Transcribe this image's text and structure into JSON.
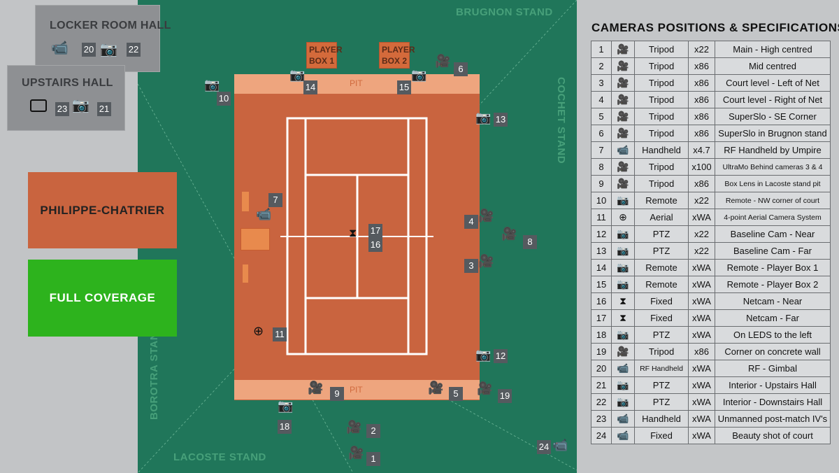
{
  "stands": {
    "brugnon": "BRUGNON STAND",
    "cochet": "COCHET STAND",
    "borotra": "BOROTRA STAND",
    "lacoste": "LACOSTE STAND"
  },
  "halls": {
    "locker_room": {
      "title": "LOCKER ROOM HALL",
      "cams": [
        "20",
        "22"
      ]
    },
    "upstairs": {
      "title": "UPSTAIRS HALL",
      "cams": [
        "23",
        "21"
      ]
    }
  },
  "court_name": "PHILIPPE-CHATRIER",
  "coverage_label": "FULL COVERAGE",
  "colors": {
    "field": "#20765a",
    "court": "#c9643f",
    "coverage": "#2db31d",
    "panel": "#c4c6c8"
  },
  "court": {
    "player_box_1": [
      "PLAYER",
      "BOX 1"
    ],
    "player_box_2": [
      "PLAYER",
      "BOX 2"
    ],
    "pit_top": "PIT",
    "pit_bottom": "PIT"
  },
  "camera_labels": {
    "c1": "1",
    "c2": "2",
    "c3": "3",
    "c4": "4",
    "c5": "5",
    "c6": "6",
    "c7": "7",
    "c8": "8",
    "c9": "9",
    "c10": "10",
    "c11": "11",
    "c12": "12",
    "c13": "13",
    "c14": "14",
    "c15": "15",
    "c16": "16",
    "c17": "17",
    "c18": "18",
    "c19": "19",
    "c24": "24"
  },
  "table": {
    "title": "CAMERAS POSITIONS & SPECIFICATIONS:",
    "rows": [
      {
        "num": "1",
        "icon": "tripod-camera-icon",
        "mount": "Tripod",
        "lens": "x22",
        "desc": "Main - High centred"
      },
      {
        "num": "2",
        "icon": "tripod-camera-icon",
        "mount": "Tripod",
        "lens": "x86",
        "desc": "Mid centred"
      },
      {
        "num": "3",
        "icon": "tripod-camera-icon",
        "mount": "Tripod",
        "lens": "x86",
        "desc": "Court level - Left of Net"
      },
      {
        "num": "4",
        "icon": "tripod-camera-icon",
        "mount": "Tripod",
        "lens": "x86",
        "desc": "Court level - Right of Net"
      },
      {
        "num": "5",
        "icon": "tripod-camera-icon",
        "mount": "Tripod",
        "lens": "x86",
        "desc": "SuperSlo - SE Corner"
      },
      {
        "num": "6",
        "icon": "tripod-camera-icon",
        "mount": "Tripod",
        "lens": "x86",
        "desc": "SuperSlo in Brugnon stand"
      },
      {
        "num": "7",
        "icon": "handheld-camera-icon",
        "mount": "Handheld",
        "lens": "x4.7",
        "desc": "RF Handheld by Umpire"
      },
      {
        "num": "8",
        "icon": "tripod-camera-icon",
        "mount": "Tripod",
        "lens": "x100",
        "desc": "UltraMo Behind cameras 3 & 4"
      },
      {
        "num": "9",
        "icon": "tripod-camera-icon",
        "mount": "Tripod",
        "lens": "x86",
        "desc": "Box Lens in Lacoste stand pit"
      },
      {
        "num": "10",
        "icon": "remote-camera-icon",
        "mount": "Remote",
        "lens": "x22",
        "desc": "Remote - NW corner of court"
      },
      {
        "num": "11",
        "icon": "aerial-camera-icon",
        "mount": "Aerial",
        "lens": "xWA",
        "desc": "4-point Aerial Camera System"
      },
      {
        "num": "12",
        "icon": "ptz-camera-icon",
        "mount": "PTZ",
        "lens": "x22",
        "desc": "Baseline Cam - Near"
      },
      {
        "num": "13",
        "icon": "ptz-camera-icon",
        "mount": "PTZ",
        "lens": "x22",
        "desc": "Baseline Cam - Far"
      },
      {
        "num": "14",
        "icon": "remote-camera-icon",
        "mount": "Remote",
        "lens": "xWA",
        "desc": "Remote - Player Box 1"
      },
      {
        "num": "15",
        "icon": "remote-camera-icon",
        "mount": "Remote",
        "lens": "xWA",
        "desc": "Remote - Player Box 2"
      },
      {
        "num": "16",
        "icon": "netcam-icon",
        "mount": "Fixed",
        "lens": "xWA",
        "desc": "Netcam - Near"
      },
      {
        "num": "17",
        "icon": "netcam-icon",
        "mount": "Fixed",
        "lens": "xWA",
        "desc": "Netcam - Far"
      },
      {
        "num": "18",
        "icon": "ptz-camera-icon",
        "mount": "PTZ",
        "lens": "xWA",
        "desc": "On LEDS to the left"
      },
      {
        "num": "19",
        "icon": "tripod-camera-icon",
        "mount": "Tripod",
        "lens": "x86",
        "desc": "Corner on concrete wall"
      },
      {
        "num": "20",
        "icon": "handheld-camera-icon",
        "mount": "RF Handheld",
        "lens": "xWA",
        "desc": "RF - Gimbal"
      },
      {
        "num": "21",
        "icon": "ptz-camera-icon",
        "mount": "PTZ",
        "lens": "xWA",
        "desc": "Interior - Upstairs Hall"
      },
      {
        "num": "22",
        "icon": "ptz-camera-icon",
        "mount": "PTZ",
        "lens": "xWA",
        "desc": "Interior - Downstairs Hall"
      },
      {
        "num": "23",
        "icon": "handheld-camera-icon",
        "mount": "Handheld",
        "lens": "xWA",
        "desc": "Unmanned post-match IV's"
      },
      {
        "num": "24",
        "icon": "fixed-camera-icon",
        "mount": "Fixed",
        "lens": "xWA",
        "desc": "Beauty shot of court"
      }
    ]
  }
}
